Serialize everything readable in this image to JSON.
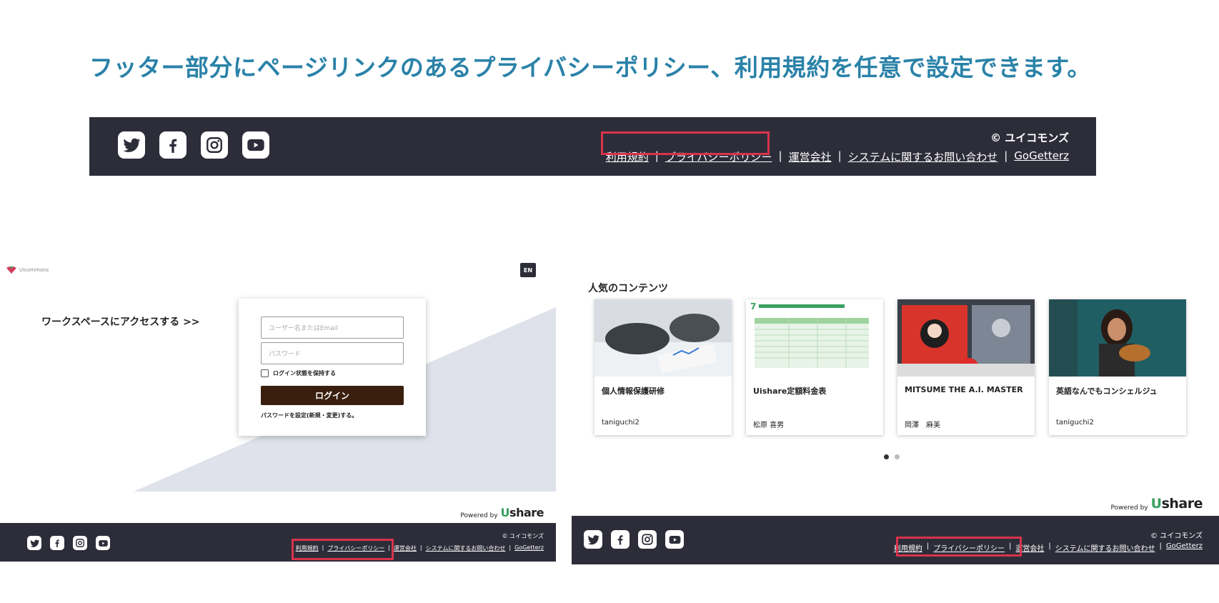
{
  "headline": "フッター部分にページリンクのあるプライバシーポリシー、利用規約を任意で設定できます。",
  "footer": {
    "copyright": "© ユイコモンズ",
    "links": [
      "利用規約",
      "プライバシーポリシー",
      "運営会社",
      "システムに関するお問い合わせ",
      "GoGetterz"
    ],
    "separator": "|",
    "social_icons": [
      "twitter-icon",
      "facebook-icon",
      "instagram-icon",
      "youtube-icon"
    ],
    "highlight_color": "#d8334a",
    "bg_color": "#2d2d3a"
  },
  "login": {
    "logo_text": "Uicommons",
    "lang_button": "EN",
    "access_heading": "ワークスペースにアクセスする >>",
    "username_placeholder": "ユーザー名またはEmail",
    "password_placeholder": "パスワード",
    "remember_label": "ログイン状態を保持する",
    "login_button": "ログイン",
    "password_link": "パスワードを設定(新規・変更)する。"
  },
  "powered_by": {
    "label": "Powered by",
    "brand_u": "U",
    "brand_rest": "share"
  },
  "contents": {
    "heading": "人気のコンテンツ",
    "cards": [
      {
        "title": "個人情報保護研修",
        "author": "taniguchi2"
      },
      {
        "title": "Uishare定額料金表",
        "author": "松原 喜男"
      },
      {
        "title": "MITSUME THE A.I. MASTER",
        "author": "岡澤　麻美"
      },
      {
        "title": "英語なんでもコンシェルジュ",
        "author": "taniguchi2"
      }
    ],
    "dots_total": 2,
    "dots_active": 1
  }
}
